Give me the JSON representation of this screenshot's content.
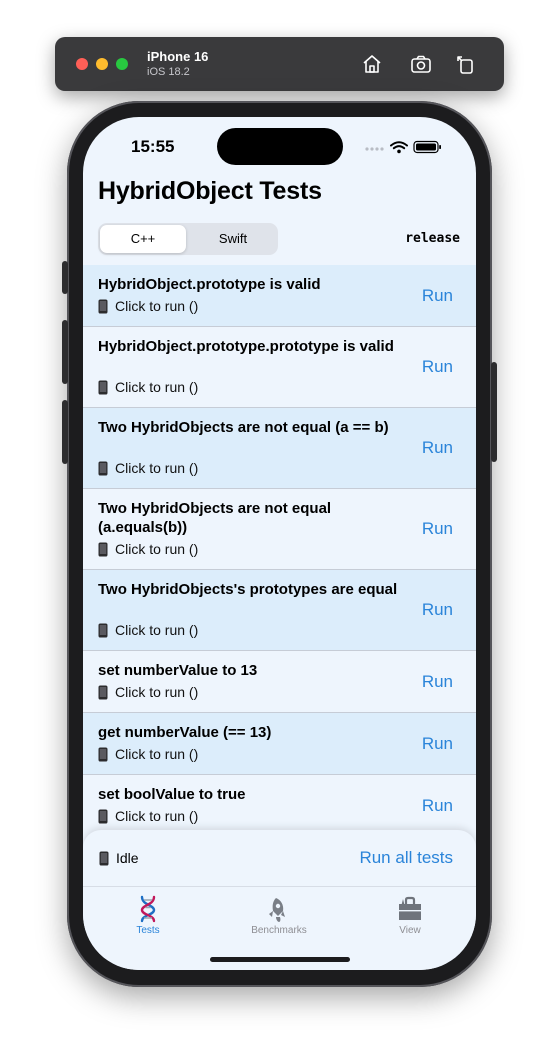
{
  "simulator": {
    "device_name": "iPhone 16",
    "os_version": "iOS 18.2",
    "icons": [
      "home-icon",
      "screenshot-icon",
      "rotate-icon"
    ]
  },
  "status_bar": {
    "time": "15:55"
  },
  "header": {
    "title": "HybridObject Tests"
  },
  "segment": {
    "options": [
      "C++",
      "Swift"
    ],
    "selected": "C++"
  },
  "build_mode": "release",
  "tests": [
    {
      "title": "HybridObject.prototype is valid",
      "status": "Click to run ()",
      "action": "Run"
    },
    {
      "title": "HybridObject.prototype.prototype is valid",
      "status": "Click to run ()",
      "action": "Run"
    },
    {
      "title": "Two HybridObjects are not equal (a == b)",
      "status": "Click to run ()",
      "action": "Run"
    },
    {
      "title": "Two HybridObjects are not equal (a.equals(b))",
      "status": "Click to run ()",
      "action": "Run"
    },
    {
      "title": "Two HybridObjects's prototypes are equal",
      "status": "Click to run ()",
      "action": "Run"
    },
    {
      "title": "set numberValue to 13",
      "status": "Click to run ()",
      "action": "Run"
    },
    {
      "title": "get numberValue (== 13)",
      "status": "Click to run ()",
      "action": "Run"
    },
    {
      "title": "set boolValue to true",
      "status": "Click to run ()",
      "action": "Run"
    }
  ],
  "footer": {
    "status": "Idle",
    "run_all_label": "Run all tests"
  },
  "tabs": [
    {
      "label": "Tests",
      "icon": "dna-icon",
      "active": true
    },
    {
      "label": "Benchmarks",
      "icon": "rocket-icon",
      "active": false
    },
    {
      "label": "View",
      "icon": "toolbox-icon",
      "active": false
    }
  ],
  "colors": {
    "accent": "#2a84d9",
    "row_alt": "#dcedfb",
    "background": "#eef5fd",
    "inactive_tab": "#8e8e93"
  }
}
